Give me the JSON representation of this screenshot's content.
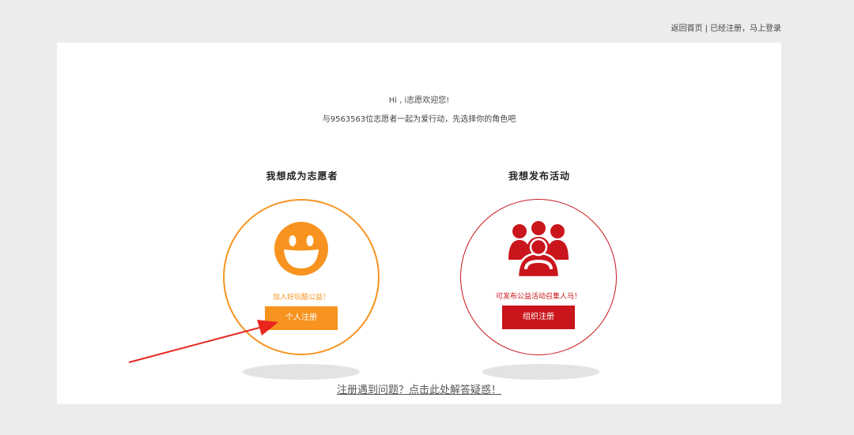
{
  "top_links": {
    "home": "返回首页",
    "separator": "|",
    "login": "已经注册，马上登录"
  },
  "welcome": {
    "greeting": "Hi , i志愿欢迎您!",
    "subtitle": "与9563563位志愿者一起为爱行动，先选择你的角色吧"
  },
  "roles": [
    {
      "title": "我想成为志愿者",
      "tagline": "加入好玩酷公益！",
      "button_label": "个人注册",
      "icon": "smiley-icon",
      "color": "#f7931e"
    },
    {
      "title": "我想发布活动",
      "tagline": "可发布公益活动召集人马！",
      "button_label": "组织注册",
      "icon": "group-people-icon",
      "color": "#c9151b"
    }
  ],
  "help": {
    "text": "注册遇到问题？点击此处解答疑惑！"
  },
  "annotation": {
    "arrow_color": "#e8261e"
  }
}
